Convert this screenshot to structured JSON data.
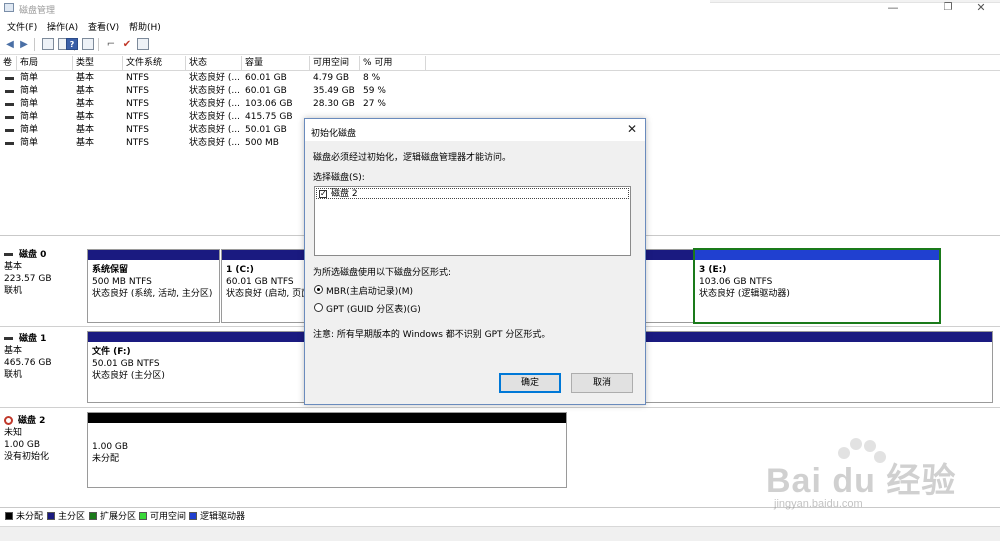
{
  "window": {
    "title": "磁盘管理"
  },
  "menu": [
    "文件(F)",
    "操作(A)",
    "查看(V)",
    "帮助(H)"
  ],
  "volume_list": {
    "columns": [
      "卷",
      "布局",
      "类型",
      "文件系统",
      "状态",
      "容量",
      "可用空间",
      "% 可用"
    ],
    "rows": [
      {
        "layout": "简单",
        "type": "基本",
        "fs": "NTFS",
        "status": "状态良好 (...",
        "capacity": "60.01 GB",
        "free": "4.79 GB",
        "pct": "8 %"
      },
      {
        "layout": "简单",
        "type": "基本",
        "fs": "NTFS",
        "status": "状态良好 (...",
        "capacity": "60.01 GB",
        "free": "35.49 GB",
        "pct": "59 %"
      },
      {
        "layout": "简单",
        "type": "基本",
        "fs": "NTFS",
        "status": "状态良好 (...",
        "capacity": "103.06 GB",
        "free": "28.30 GB",
        "pct": "27 %"
      },
      {
        "layout": "简单",
        "type": "基本",
        "fs": "NTFS",
        "status": "状态良好 (...",
        "capacity": "415.75 GB",
        "free": "",
        "pct": ""
      },
      {
        "layout": "简单",
        "type": "基本",
        "fs": "NTFS",
        "status": "状态良好 (...",
        "capacity": "50.01 GB",
        "free": "",
        "pct": ""
      },
      {
        "layout": "简单",
        "type": "基本",
        "fs": "NTFS",
        "status": "状态良好 (...",
        "capacity": "500 MB",
        "free": "",
        "pct": ""
      }
    ]
  },
  "disks": [
    {
      "name": "磁盘 0",
      "type": "基本",
      "size": "223.57 GB",
      "state": "联机",
      "partitions": [
        {
          "name": "系统保留",
          "size": "500 MB NTFS",
          "status": "状态良好 (系统, 活动, 主分区)"
        },
        {
          "name": "1  (C:)",
          "size": "60.01 GB NTFS",
          "status": "状态良好 (启动, 页面"
        },
        {
          "name": "3  (E:)",
          "size": "103.06 GB NTFS",
          "status": "状态良好 (逻辑驱动器)"
        }
      ]
    },
    {
      "name": "磁盘 1",
      "type": "基本",
      "size": "465.76 GB",
      "state": "联机",
      "partitions": [
        {
          "name": "文件  (F:)",
          "size": "50.01 GB NTFS",
          "status": "状态良好 (主分区)"
        }
      ]
    },
    {
      "name": "磁盘 2",
      "type": "未知",
      "size": "1.00 GB",
      "state": "没有初始化",
      "partitions": [
        {
          "name": "",
          "size": "1.00 GB",
          "status": "未分配"
        }
      ]
    }
  ],
  "legend": [
    {
      "label": "未分配",
      "color": "#000000"
    },
    {
      "label": "主分区",
      "color": "#1a1a80"
    },
    {
      "label": "扩展分区",
      "color": "#1a7a1a"
    },
    {
      "label": "可用空间",
      "color": "#3ad83a"
    },
    {
      "label": "逻辑驱动器",
      "color": "#2040d0"
    }
  ],
  "dialog": {
    "title": "初始化磁盘",
    "message": "磁盘必须经过初始化，逻辑磁盘管理器才能访问。",
    "select_label": "选择磁盘(S):",
    "disk_item": "磁盘 2",
    "style_label": "为所选磁盘使用以下磁盘分区形式:",
    "option_mbr": "MBR(主启动记录)(M)",
    "option_gpt": "GPT (GUID 分区表)(G)",
    "note": "注意: 所有早期版本的 Windows 都不识别 GPT 分区形式。",
    "ok": "确定",
    "cancel": "取消"
  },
  "watermark": {
    "text": "Bai du 经验",
    "url": "jingyan.baidu.com"
  }
}
